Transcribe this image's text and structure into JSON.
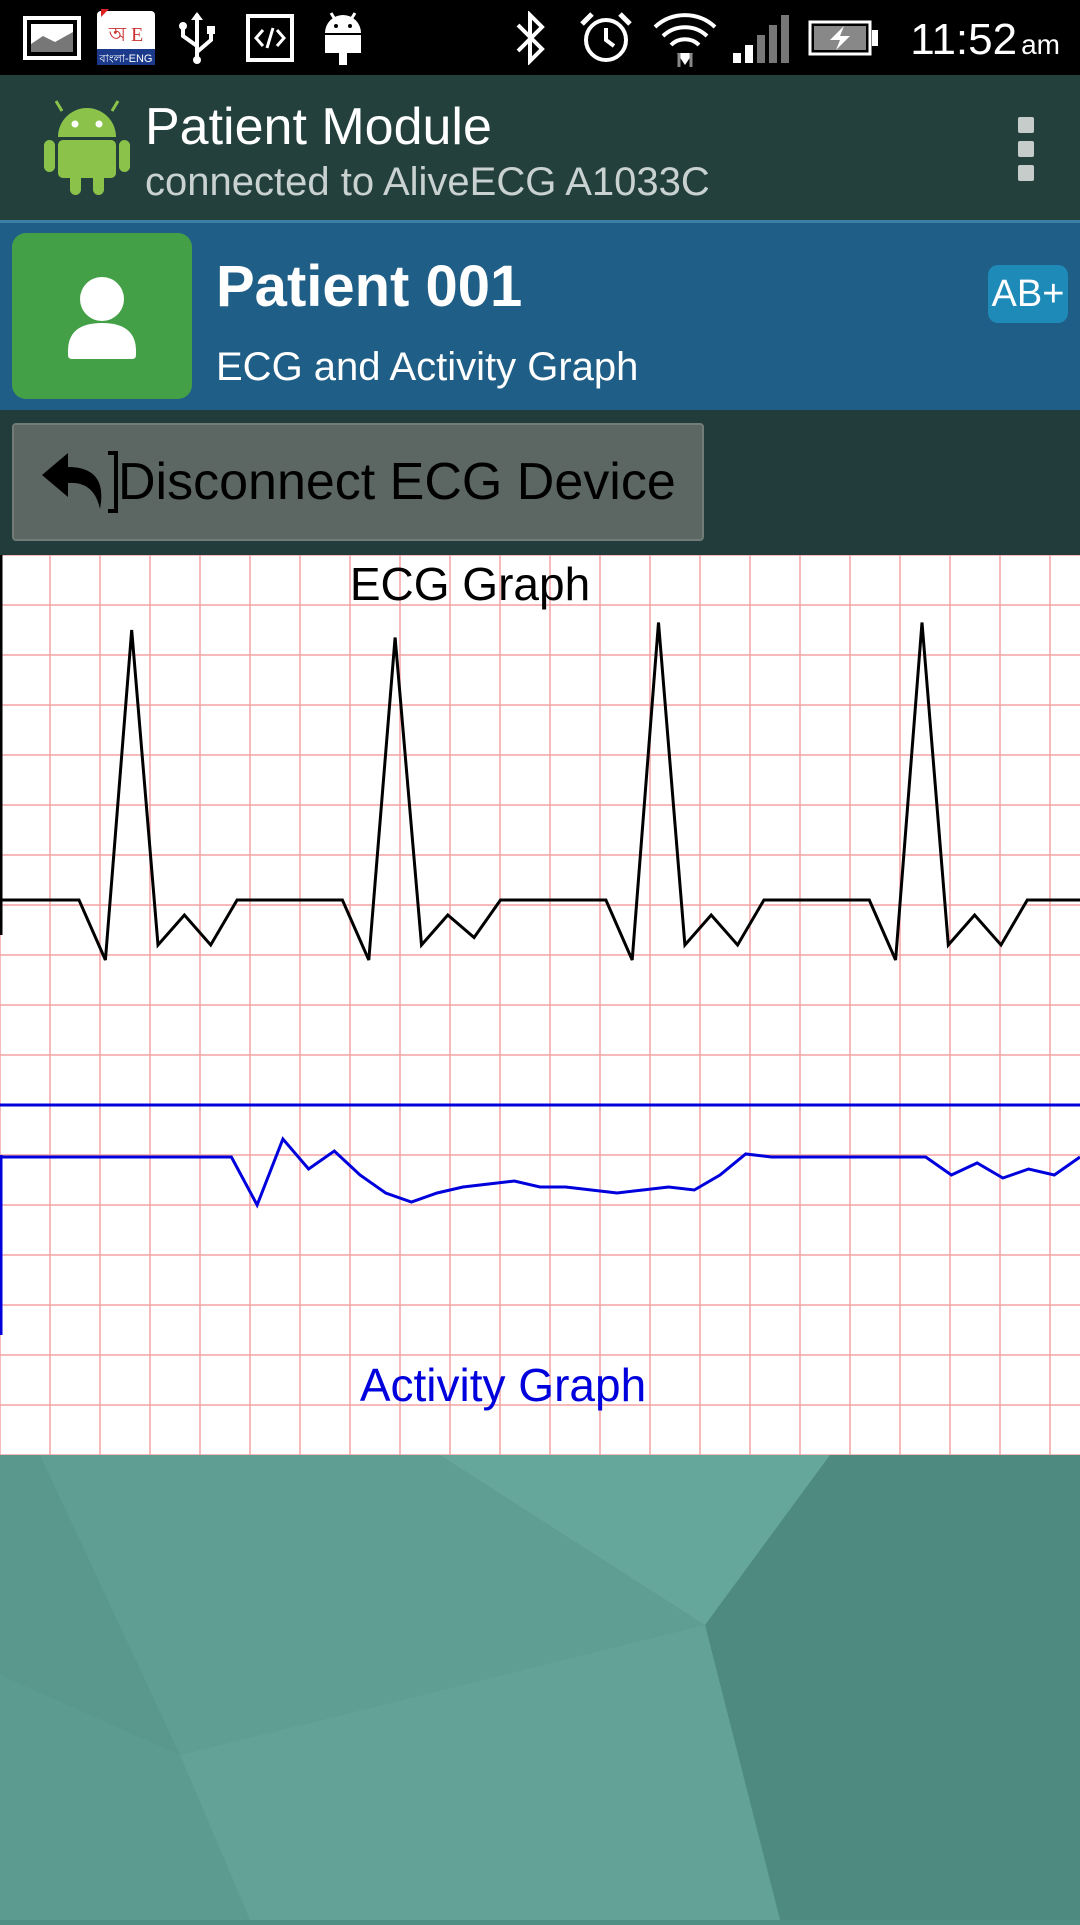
{
  "status_bar": {
    "time": "11:52",
    "ampm": "am",
    "icons": [
      "image-icon",
      "bangla-eng-keyboard-icon",
      "usb-icon",
      "code-icon",
      "android-debug-icon",
      "bluetooth-icon",
      "alarm-icon",
      "wifi-icon",
      "signal-icon",
      "battery-charging-icon"
    ],
    "app_badge_top": "অ E",
    "app_badge_bottom": "বাংলা-ENG"
  },
  "action_bar": {
    "title": "Patient Module",
    "subtitle": "connected to AliveECG A1033C",
    "icon": "android-icon",
    "menu_icon": "overflow-menu-icon"
  },
  "patient": {
    "name": "Patient 001",
    "subtitle": "ECG and Activity Graph",
    "blood_type": "AB+",
    "avatar_icon": "person-icon"
  },
  "toolbar": {
    "disconnect_label": "Disconnect ECG Device",
    "disconnect_icon": "reply-icon"
  },
  "colors": {
    "ecg_trace": "#000000",
    "activity_trace": "#0000dd",
    "grid": "#f4a3a3",
    "patient_header": "#1f5e86",
    "avatar_tile": "#43a047"
  },
  "chart_data": [
    {
      "type": "line",
      "title": "ECG Graph",
      "series": [
        {
          "values": [
            0,
            0,
            0,
            0,
            -0.4,
            1.8,
            -0.3,
            -0.1,
            -0.3,
            0,
            0,
            0,
            0,
            0,
            -0.4,
            1.75,
            -0.3,
            -0.1,
            -0.25,
            0,
            0,
            0,
            0,
            0,
            -0.4,
            1.85,
            -0.3,
            -0.1,
            -0.3,
            0,
            0,
            0,
            0,
            0,
            -0.4,
            1.85,
            -0.3,
            -0.1,
            -0.3,
            0,
            0,
            0
          ]
        }
      ],
      "grid": true
    },
    {
      "type": "line",
      "title": "Activity Graph",
      "series": [
        {
          "values": [
            0,
            0,
            0,
            0,
            0,
            0,
            0,
            0,
            0,
            0,
            -0.8,
            0.3,
            -0.2,
            0.1,
            -0.3,
            -0.6,
            -0.75,
            -0.6,
            -0.5,
            -0.45,
            -0.4,
            -0.5,
            -0.5,
            -0.55,
            -0.6,
            -0.55,
            -0.5,
            -0.55,
            -0.3,
            0.05,
            0,
            0,
            0,
            0,
            0,
            0,
            0,
            -0.3,
            -0.1,
            -0.35,
            -0.2,
            -0.3,
            0
          ]
        }
      ],
      "grid": true
    }
  ]
}
